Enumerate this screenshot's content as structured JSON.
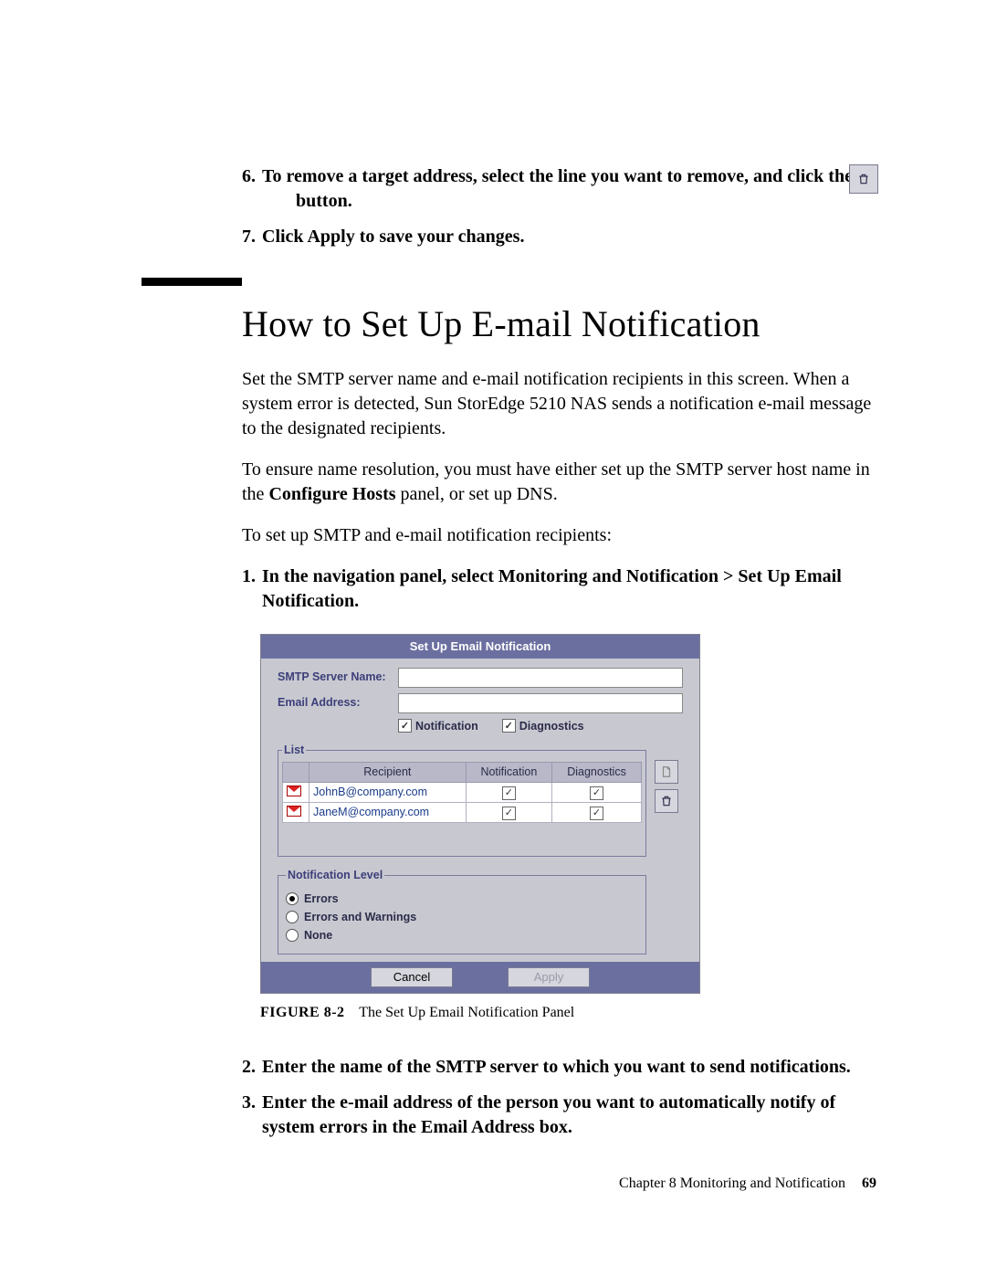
{
  "steps_a": [
    {
      "num": "6.",
      "body_prefix": "To remove a target address, select the line you want to remove, and click the ",
      "body_suffix": "button."
    },
    {
      "num": "7.",
      "body": "Click Apply to save your changes."
    }
  ],
  "heading": "How to Set Up E-mail Notification",
  "paragraphs": [
    "Set the SMTP server name and e-mail notification recipients in this screen. When a system error is detected, Sun StorEdge 5210 NAS sends a notification e-mail message to the designated recipients.",
    "To ensure name resolution, you must have either set up the SMTP server host name in the Configure Hosts panel, or set up DNS.",
    "To set up SMTP and e-mail notification recipients:"
  ],
  "para_bold_segment": "Configure Hosts",
  "steps_b": [
    {
      "num": "1.",
      "body": "In the navigation panel, select Monitoring and Notification > Set Up Email Notification."
    },
    {
      "num": "2.",
      "body": "Enter the name of the SMTP server to which you want to send notifications."
    },
    {
      "num": "3.",
      "body": "Enter the e-mail address of the person you want to automatically notify of system errors in the Email Address box."
    }
  ],
  "panel": {
    "title": "Set Up Email Notification",
    "smtp_label": "SMTP Server Name:",
    "email_label": "Email Address:",
    "cb_notification": "Notification",
    "cb_diagnostics": "Diagnostics",
    "list_legend": "List",
    "cols": {
      "recipient": "Recipient",
      "notification": "Notification",
      "diagnostics": "Diagnostics"
    },
    "rows": [
      {
        "email": "JohnB@company.com",
        "notif": true,
        "diag": true
      },
      {
        "email": "JaneM@company.com",
        "notif": true,
        "diag": true
      }
    ],
    "level_legend": "Notification Level",
    "levels": [
      {
        "label": "Errors",
        "selected": true
      },
      {
        "label": "Errors and Warnings",
        "selected": false
      },
      {
        "label": "None",
        "selected": false
      }
    ],
    "cancel": "Cancel",
    "apply": "Apply"
  },
  "figure": {
    "label": "FIGURE 8-2",
    "caption": "The Set Up Email Notification Panel"
  },
  "footer": {
    "chapter": "Chapter 8   Monitoring and Notification",
    "page": "69"
  }
}
